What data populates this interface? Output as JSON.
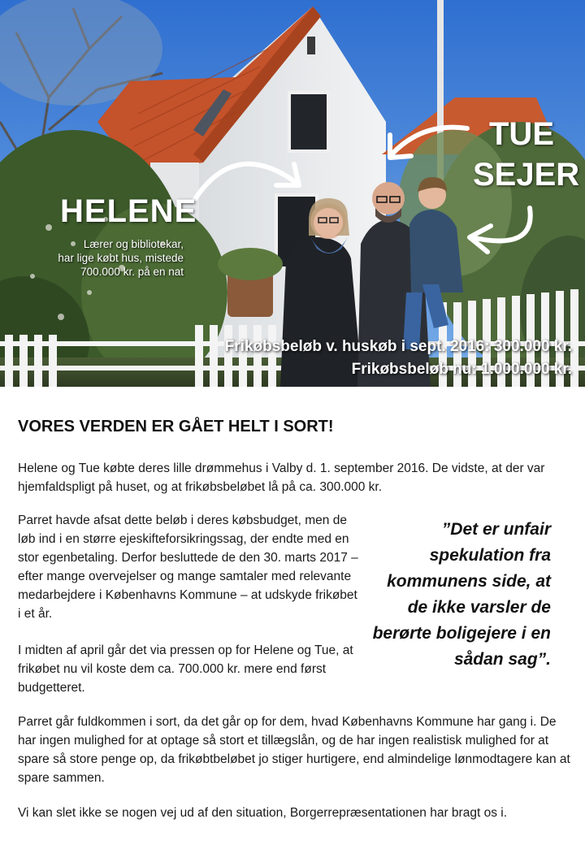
{
  "photo": {
    "helene_name": "HELENE",
    "helene_desc_lines": [
      "Lærer og bibliotekar,",
      "har lige købt hus, mistede",
      "700.000 kr. på en nat"
    ],
    "tue_name_lines": [
      "TUE",
      "SEJER"
    ],
    "amount_lines": [
      "Frikøbsbeløb v. huskøb i sept. 2016: 300.000 kr.",
      "Frikøbsbeløb nu: 1.000.000  kr."
    ]
  },
  "article": {
    "headline": "VORES VERDEN ER GÅET HELT I SORT!",
    "paragraph_1": "Helene og Tue købte deres lille drømmehus i Valby d. 1. september 2016. De vidste, at der var hjemfaldspligt på huset, og at frikøbsbeløbet lå på ca. 300.000 kr.",
    "paragraph_2": "Parret havde afsat dette beløb i deres købsbudget, men de løb ind i en større ejeskifteforsikringssag, der endte med en stor egenbetaling. Derfor besluttede de den 30. marts 2017 – efter mange overvejelser og mange samtaler med relevante medarbejdere i Københavns Kommune – at udskyde frikøbet i et år.",
    "paragraph_3": "I midten af april går det via pressen op for Helene og Tue, at frikøbet nu vil koste dem ca. 700.000 kr. mere end først budgetteret.",
    "paragraph_4": "Parret går fuldkommen i sort, da det går op for dem, hvad Københavns Kommune har gang i. De har ingen mulighed for at optage så stort et tillægslån, og de har ingen realistisk mulighed for at spare så store penge op, da frikøbtbeløbet jo stiger hurtigere, end almindelige lønmodtagere kan at spare sammen.",
    "paragraph_5": "Vi kan slet ikke se nogen vej ud af den situation, Borgerrepræsentationen har bragt os i.",
    "quote": "”Det er unfair spekulation fra kommunens side, at de ikke varsler de berørte boligejere i en sådan sag”."
  },
  "colors": {
    "sky": "#3f7fd6",
    "roof": "#c4522a",
    "wall": "#e9ebec",
    "foliage": "#3c5a2a",
    "text": "#111111"
  }
}
